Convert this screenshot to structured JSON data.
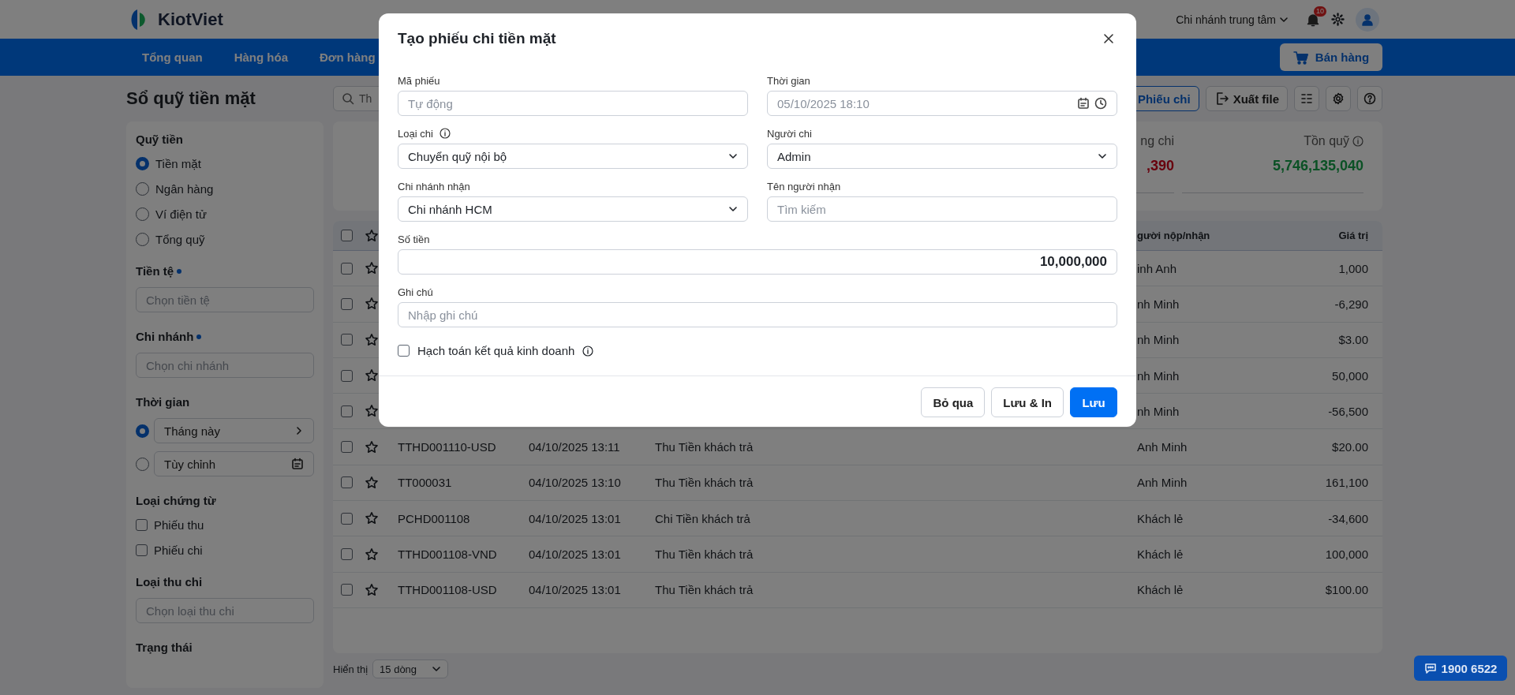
{
  "header": {
    "logo": "KiotViet",
    "branch": "Chi nhánh trung tâm",
    "notification_count": "10"
  },
  "nav": {
    "items": [
      "Tổng quan",
      "Hàng hóa",
      "Đơn hàng"
    ],
    "sell_button": "Bán hàng"
  },
  "page_title": "Sổ quỹ tiền mặt",
  "sidebar": {
    "sections": [
      {
        "kind": "radios",
        "title": "Quỹ tiền",
        "options": [
          {
            "label": "Tiền mặt",
            "selected": true
          },
          {
            "label": "Ngân hàng",
            "selected": false
          },
          {
            "label": "Ví điện tử",
            "selected": false
          },
          {
            "label": "Tổng quỹ",
            "selected": false
          }
        ]
      },
      {
        "kind": "field",
        "title": "Tiền tệ",
        "required": true,
        "placeholder": "Chọn tiền tệ"
      },
      {
        "kind": "field",
        "title": "Chi nhánh",
        "required": true,
        "placeholder": "Chọn chi nhánh"
      },
      {
        "kind": "period",
        "title": "Thời gian",
        "options": [
          {
            "label": "Tháng này",
            "selected": true,
            "kind": "next"
          },
          {
            "label": "Tùy chỉnh",
            "selected": false,
            "kind": "calendar"
          }
        ]
      },
      {
        "kind": "checks",
        "title": "Loại chứng từ",
        "options": [
          {
            "label": "Phiếu thu",
            "checked": false
          },
          {
            "label": "Phiếu chi",
            "checked": false
          }
        ]
      },
      {
        "kind": "field",
        "title": "Loại thu chi",
        "required": false,
        "placeholder": "Chọn loại thu chi"
      },
      {
        "kind": "heading",
        "title": "Trạng thái"
      }
    ]
  },
  "toolbar": {
    "search_placeholder": "Th",
    "buttons": [
      {
        "kind": "outline",
        "label": "Phiếu chi"
      },
      {
        "kind": "export",
        "label": "Xuất file"
      },
      {
        "kind": "columns"
      },
      {
        "kind": "settings"
      },
      {
        "kind": "help"
      }
    ]
  },
  "summary": [
    {
      "label": "ng chi",
      "value": ",390",
      "kind": "negative",
      "info": false
    },
    {
      "label": "Tồn quỹ",
      "value": "5,746,135,040",
      "kind": "positive",
      "info": true
    }
  ],
  "table": {
    "all_checked": false,
    "columns": [
      {
        "kind": "person",
        "label": "gười nộp/nhận"
      },
      {
        "kind": "value",
        "label": "Giá trị"
      }
    ],
    "rows": [
      {
        "checked": false,
        "starred": false,
        "person": "inh Anh",
        "value": "1,000"
      },
      {
        "checked": false,
        "starred": false,
        "person": "nh Minh",
        "value": "-6,290"
      },
      {
        "checked": false,
        "starred": false,
        "person": "nh Minh",
        "value": "$3.00"
      },
      {
        "checked": false,
        "starred": false,
        "person": "nh Minh",
        "value": "50,000"
      },
      {
        "checked": false,
        "starred": false,
        "person": "nh Minh",
        "value": "-56,500"
      },
      {
        "checked": false,
        "starred": false,
        "code": "TTHD001110-USD",
        "time": "04/10/2025 13:11",
        "description": "Thu Tiền khách trả",
        "person": "Anh Minh",
        "value": "$20.00"
      },
      {
        "checked": false,
        "starred": false,
        "code": "TT000031",
        "time": "04/10/2025 13:10",
        "description": "Thu Tiền khách trả",
        "person": "Anh Minh",
        "value": "161,100"
      },
      {
        "checked": false,
        "starred": false,
        "code": "PCHD001108",
        "time": "04/10/2025 13:01",
        "description": "Chi Tiền khách trả",
        "person": "Khách lẻ",
        "value": "-34,600"
      },
      {
        "checked": false,
        "starred": false,
        "code": "TTHD001108-VND",
        "time": "04/10/2025 13:01",
        "description": "Thu Tiền khách trả",
        "person": "Khách lẻ",
        "value": "100,000"
      },
      {
        "checked": false,
        "starred": false,
        "code": "TTHD001108-USD",
        "time": "04/10/2025 13:01",
        "description": "Thu Tiền khách trả",
        "person": "Khách lẻ",
        "value": "$100.00"
      }
    ]
  },
  "footer": {
    "label": "Hiển thị",
    "page_size": "15 dòng"
  },
  "hotline": "1900 6522",
  "modal": {
    "title": "Tạo phiếu chi tiền mặt",
    "fields": [
      {
        "kind": "text",
        "label": "Mã phiếu",
        "placeholder": "Tự động"
      },
      {
        "kind": "datetime",
        "label": "Thời gian",
        "placeholder": "05/10/2025 18:10"
      },
      {
        "kind": "select",
        "label": "Loại chi",
        "info": true,
        "value": "Chuyển quỹ nội bộ"
      },
      {
        "kind": "select",
        "label": "Người chi",
        "value": "Admin"
      },
      {
        "kind": "select",
        "label": "Chi nhánh nhận",
        "value": "Chi nhánh HCM"
      },
      {
        "kind": "text",
        "label": "Tên người nhận",
        "placeholder": "Tìm kiếm"
      },
      {
        "kind": "amount",
        "label": "Số tiền",
        "value": "10,000,000"
      },
      {
        "kind": "wide",
        "label": "Ghi chú",
        "placeholder": "Nhập ghi chú"
      }
    ],
    "option": {
      "label": "Hạch toán kết quả kinh doanh",
      "checked": false,
      "info": true
    },
    "buttons": [
      {
        "kind": "secondary",
        "label": "Bỏ qua"
      },
      {
        "kind": "secondary",
        "label": "Lưu & In"
      },
      {
        "kind": "primary",
        "label": "Lưu"
      }
    ]
  }
}
